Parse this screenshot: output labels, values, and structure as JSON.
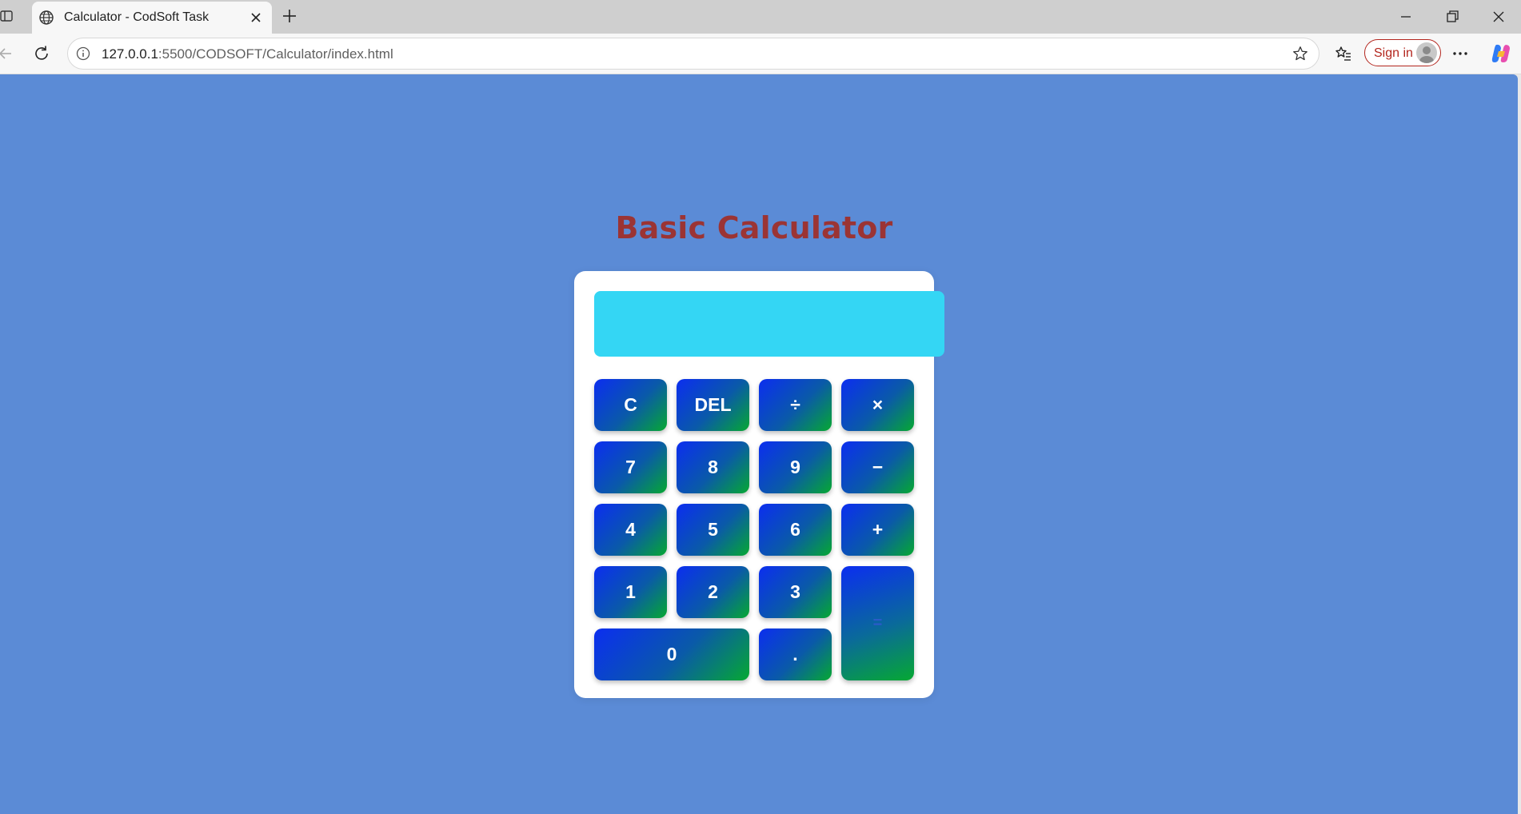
{
  "browser": {
    "tab_title": "Calculator - CodSoft Task",
    "url_host": "127.0.0.1",
    "url_path": ":5500/CODSOFT/Calculator/index.html",
    "sign_in_label": "Sign in"
  },
  "page": {
    "title": "Basic Calculator",
    "background_color": "#5b8bd6",
    "title_color": "#9b3434"
  },
  "calculator": {
    "display_value": "",
    "display_color": "#34d6f4",
    "keys": {
      "clear": "C",
      "delete": "DEL",
      "divide": "÷",
      "multiply": "×",
      "seven": "7",
      "eight": "8",
      "nine": "9",
      "subtract": "−",
      "four": "4",
      "five": "5",
      "six": "6",
      "add": "+",
      "one": "1",
      "two": "2",
      "three": "3",
      "equals": "=",
      "zero": "0",
      "decimal": "."
    }
  }
}
